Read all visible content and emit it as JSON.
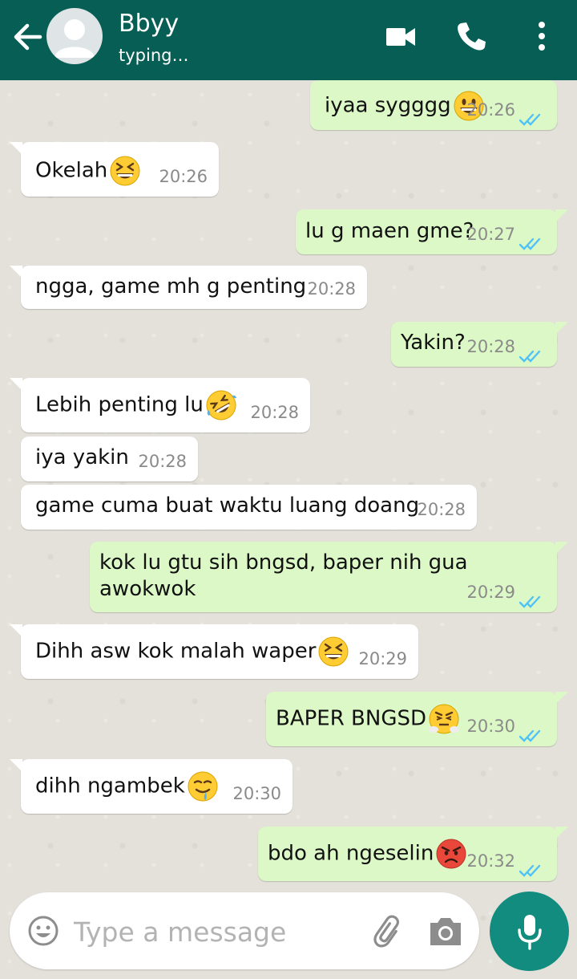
{
  "header": {
    "contact_name": "Bbyy",
    "status": "typing…",
    "colors": {
      "bar": "#075e54"
    }
  },
  "messages": [
    {
      "dir": "out",
      "text": "iyaa sygggg",
      "emoji": "grinning-face",
      "time": "20:26",
      "read": true
    },
    {
      "dir": "in",
      "text": "Okelah",
      "emoji": "laughing-squinting-face",
      "time": "20:26"
    },
    {
      "dir": "out",
      "text": "lu g maen gme?",
      "time": "20:27",
      "read": true
    },
    {
      "dir": "in",
      "text": "ngga, game mh g penting",
      "time": "20:28"
    },
    {
      "dir": "out",
      "text": "Yakin?",
      "time": "20:28",
      "read": true
    },
    {
      "dir": "in",
      "text": "Lebih penting lu",
      "emoji": "rolling-on-floor-laughing",
      "time": "20:28"
    },
    {
      "dir": "in",
      "text": "iya yakin",
      "time": "20:28"
    },
    {
      "dir": "in",
      "text": "game cuma buat waktu luang doang",
      "time": "20:28"
    },
    {
      "dir": "out",
      "text": "kok lu gtu sih bngsd, baper nih gua awokwok",
      "time": "20:29",
      "read": true
    },
    {
      "dir": "in",
      "text": "Dihh asw kok malah waper",
      "emoji": "laughing-squinting-face",
      "time": "20:29"
    },
    {
      "dir": "out",
      "text": "BAPER BNGSD",
      "emoji": "face-with-steam",
      "time": "20:30",
      "read": true
    },
    {
      "dir": "in",
      "text": "dihh ngambek",
      "emoji": "drooling-face",
      "time": "20:30"
    },
    {
      "dir": "out",
      "text": "bdo ah ngeselin",
      "emoji": "pouting-face",
      "time": "20:32",
      "read": true
    }
  ],
  "composer": {
    "placeholder": "Type a message",
    "icons": [
      "emoji-icon",
      "attach-icon",
      "camera-icon",
      "mic-icon"
    ]
  },
  "colors": {
    "incoming": "#ffffff",
    "outgoing": "#dcf8c6",
    "ticks": "#4fc3f7",
    "accent": "#128c7e"
  }
}
